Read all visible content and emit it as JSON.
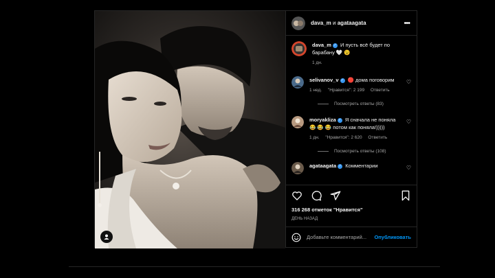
{
  "post": {
    "author": "dava_m",
    "and_word": "и",
    "coauthor": "agataagata",
    "more_icon": "more-horizontal-icon",
    "caption": {
      "user": "dava_m",
      "text": "И пусть всё будет по барабану 🤍 😉",
      "time": "1 дн."
    },
    "comments": [
      {
        "user": "selivanov_v",
        "text": "🔴 дома поговорим",
        "time": "1 нед.",
        "likes": "\"Нравится\": 2 199",
        "reply": "Ответить",
        "view_replies": "Посмотреть ответы (83)"
      },
      {
        "user": "moryakliza",
        "text": "Я сначала не поняла 😂 😂 😂 потом как поняла!)))))",
        "time": "1 дн.",
        "likes": "\"Нравится\": 2 620",
        "reply": "Ответить",
        "view_replies": "Посмотреть ответы (108)"
      },
      {
        "user": "agataagata",
        "text": "Комментарии"
      }
    ],
    "likes_count": "316 268 отметок \"Нравится\"",
    "posted_ago": "ДЕНЬ НАЗАД",
    "comment_placeholder": "Добавьте комментарий...",
    "publish_label": "Опубликовать"
  },
  "colors": {
    "background": "#000000",
    "verified": "#3897f0",
    "publish": "#0095f6",
    "secondary_text": "#a8a8a8"
  }
}
